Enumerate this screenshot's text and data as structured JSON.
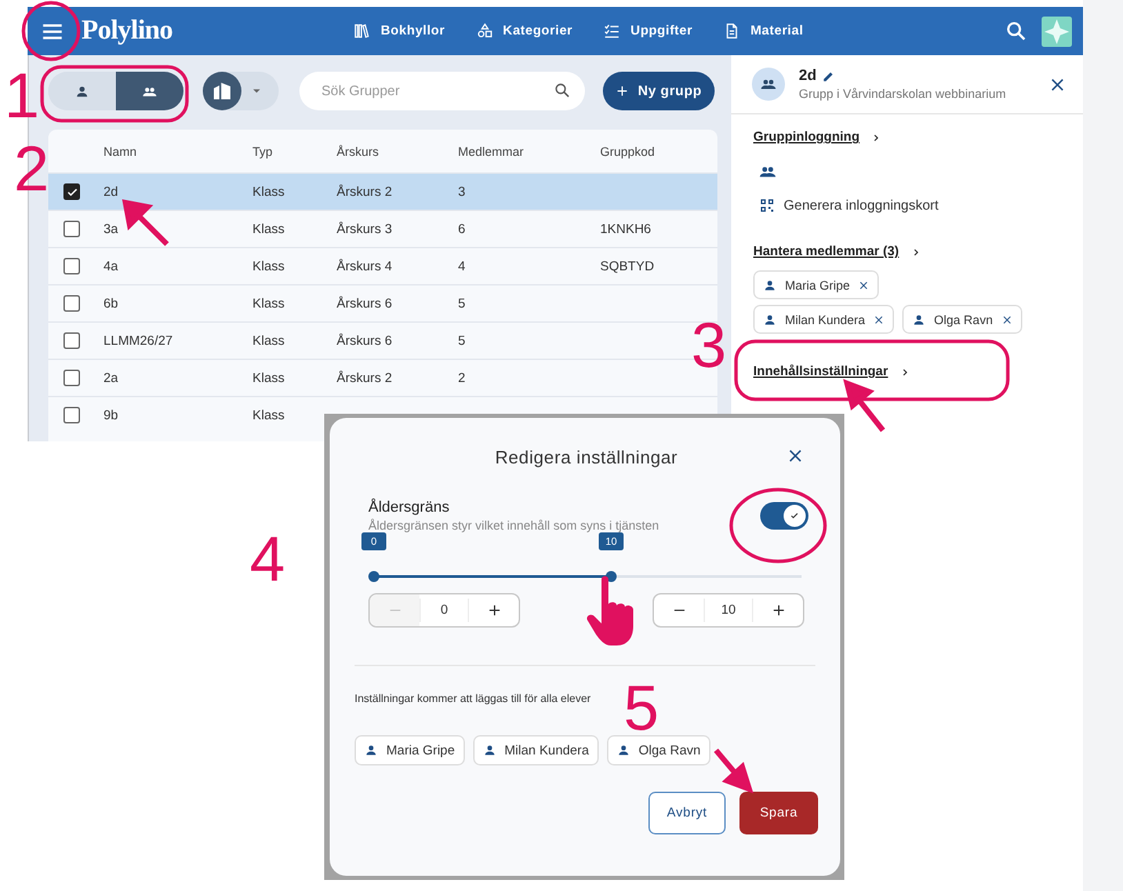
{
  "header": {
    "logo": "Polylino",
    "nav": [
      {
        "label": "Bokhyllor"
      },
      {
        "label": "Kategorier"
      },
      {
        "label": "Uppgifter"
      },
      {
        "label": "Material"
      }
    ]
  },
  "toolbar": {
    "view_toggle": [
      {
        "selected": false
      },
      {
        "selected": true
      }
    ],
    "search": {
      "placeholder": "Sök Grupper"
    },
    "new_button": "Ny grupp"
  },
  "table": {
    "columns": [
      "Namn",
      "Typ",
      "Årskurs",
      "Medlemmar",
      "Gruppkod"
    ],
    "rows": [
      {
        "selected": true,
        "cells": [
          "2d",
          "Klass",
          "Årskurs 2",
          "3",
          ""
        ]
      },
      {
        "selected": false,
        "cells": [
          "3a",
          "Klass",
          "Årskurs 3",
          "6",
          "1KNKH6"
        ]
      },
      {
        "selected": false,
        "cells": [
          "4a",
          "Klass",
          "Årskurs 4",
          "4",
          "SQBTYD"
        ]
      },
      {
        "selected": false,
        "cells": [
          "6b",
          "Klass",
          "Årskurs 6",
          "5",
          ""
        ]
      },
      {
        "selected": false,
        "cells": [
          "LLMM26/27",
          "Klass",
          "Årskurs 6",
          "5",
          ""
        ]
      },
      {
        "selected": false,
        "cells": [
          "2a",
          "Klass",
          "Årskurs 2",
          "2",
          ""
        ]
      },
      {
        "selected": false,
        "cells": [
          "9b",
          "Klass"
        ]
      }
    ]
  },
  "panel": {
    "title": "2d",
    "subtitle": "Grupp i Vårvindarskolan webbinarium",
    "group_login": "Gruppinloggning",
    "generate_cards": "Generera inloggningskort",
    "members_heading": "Hantera medlemmar (3)",
    "members": [
      "Maria Gripe",
      "Milan Kundera",
      "Olga Ravn"
    ],
    "content_settings": "Innehållsinställningar"
  },
  "dialog": {
    "title": "Redigera inställningar",
    "setting": {
      "label": "Åldersgräns",
      "description": "Åldersgränsen styr vilket innehåll som syns i tjänsten",
      "on": true
    },
    "range": [
      {
        "level": 0,
        "reading": "0"
      },
      {
        "level": 0.555,
        "reading": "10"
      }
    ],
    "steppers": [
      {
        "value": "0",
        "decrease_disabled": true
      },
      {
        "value": "10",
        "decrease_disabled": false
      }
    ],
    "note": "Inställningar kommer att läggas till för alla elever",
    "members": [
      "Maria Gripe",
      "Milan Kundera",
      "Olga Ravn"
    ],
    "buttons": [
      {
        "label": "Avbryt",
        "kind": "secondary"
      },
      {
        "label": "Spara",
        "kind": "primary"
      }
    ]
  },
  "annotations": [
    {
      "label": "1"
    },
    {
      "label": "2"
    },
    {
      "label": "3"
    },
    {
      "label": "4"
    },
    {
      "label": "5"
    }
  ]
}
